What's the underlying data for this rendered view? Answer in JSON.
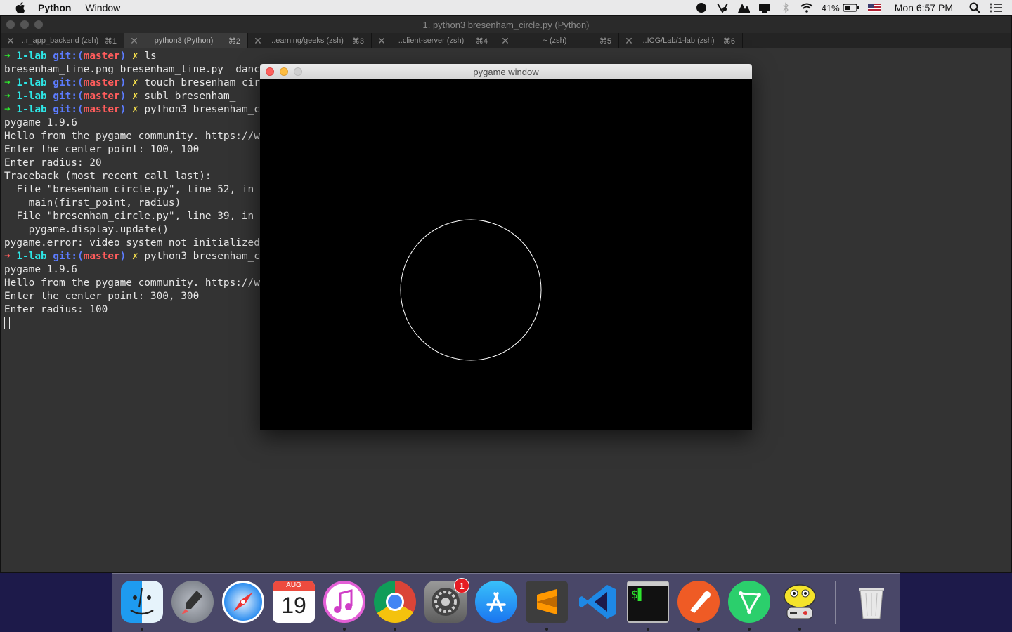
{
  "menubar": {
    "app_name": "Python",
    "menus": [
      "Window"
    ],
    "battery": "41%",
    "clock": "Mon 6:57 PM"
  },
  "terminal": {
    "title": "1. python3 bresenham_circle.py (Python)",
    "tabs": [
      {
        "title": "..r_app_backend (zsh)",
        "shortcut": "⌘1",
        "active": false
      },
      {
        "title": "python3 (Python)",
        "shortcut": "⌘2",
        "active": true
      },
      {
        "title": "..earning/geeks (zsh)",
        "shortcut": "⌘3",
        "active": false
      },
      {
        "title": "..client-server (zsh)",
        "shortcut": "⌘4",
        "active": false
      },
      {
        "title": "~ (zsh)",
        "shortcut": "⌘5",
        "active": false
      },
      {
        "title": "..ICG/Lab/1-lab (zsh)",
        "shortcut": "⌘6",
        "active": false
      }
    ],
    "prompt": {
      "arrow": "➜",
      "dir": "1-lab",
      "git_label": "git:(",
      "branch": "master",
      "git_close": ")",
      "dirty": "✗"
    },
    "lines": [
      {
        "type": "prompt",
        "status": "ok",
        "cmd": "ls"
      },
      {
        "type": "out",
        "text": "bresenham_line.png bresenham_line.py  dancing_"
      },
      {
        "type": "prompt",
        "status": "ok",
        "cmd": "touch bresenham_circle"
      },
      {
        "type": "prompt",
        "status": "ok",
        "cmd": "subl bresenham_"
      },
      {
        "type": "prompt",
        "status": "ok",
        "cmd": "python3 bresenham_circ"
      },
      {
        "type": "out",
        "text": "pygame 1.9.6"
      },
      {
        "type": "out",
        "text": "Hello from the pygame community. https://www.p"
      },
      {
        "type": "out",
        "text": "Enter the center point: 100, 100"
      },
      {
        "type": "out",
        "text": "Enter radius: 20"
      },
      {
        "type": "out",
        "text": "Traceback (most recent call last):"
      },
      {
        "type": "out",
        "text": "  File \"bresenham_circle.py\", line 52, in <mod"
      },
      {
        "type": "out",
        "text": "    main(first_point, radius)"
      },
      {
        "type": "out",
        "text": "  File \"bresenham_circle.py\", line 39, in main"
      },
      {
        "type": "out",
        "text": "    pygame.display.update()"
      },
      {
        "type": "out",
        "text": "pygame.error: video system not initialized"
      },
      {
        "type": "prompt",
        "status": "err",
        "cmd": "python3 bresenham_circ"
      },
      {
        "type": "out",
        "text": "pygame 1.9.6"
      },
      {
        "type": "out",
        "text": "Hello from the pygame community. https://www.p"
      },
      {
        "type": "out",
        "text": "Enter the center point: 300, 300"
      },
      {
        "type": "out",
        "text": "Enter radius: 100"
      },
      {
        "type": "cursor"
      }
    ]
  },
  "pygame_window": {
    "title": "pygame window",
    "circle_color": "#ffffff",
    "background": "#000000"
  },
  "dock": {
    "items": [
      {
        "name": "finder",
        "running": true
      },
      {
        "name": "launchpad",
        "running": false
      },
      {
        "name": "safari",
        "running": false
      },
      {
        "name": "calendar",
        "running": false,
        "month": "AUG",
        "day": "19"
      },
      {
        "name": "itunes",
        "running": true
      },
      {
        "name": "chrome",
        "running": true
      },
      {
        "name": "system-preferences",
        "running": false,
        "badge": "1"
      },
      {
        "name": "app-store",
        "running": false
      },
      {
        "name": "sublime-text",
        "running": true
      },
      {
        "name": "vscode",
        "running": false
      },
      {
        "name": "iterm",
        "running": true
      },
      {
        "name": "postman",
        "running": true
      },
      {
        "name": "send-app",
        "running": true
      },
      {
        "name": "pygame",
        "running": true
      },
      {
        "name": "trash",
        "running": false
      }
    ]
  }
}
